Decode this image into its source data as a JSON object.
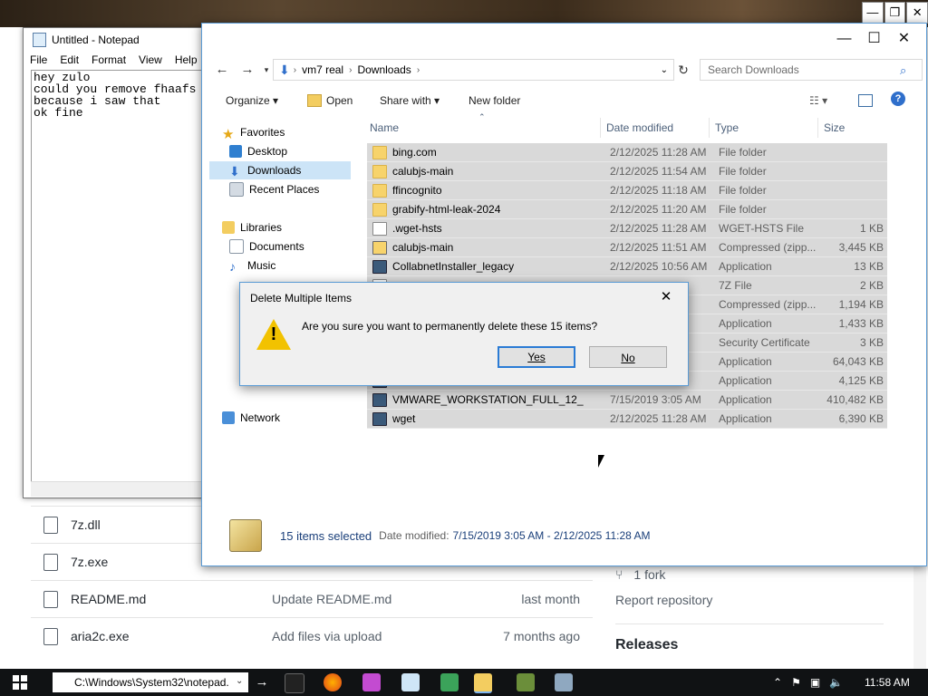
{
  "background": {
    "window_buttons": [
      "—",
      "❐",
      "✕"
    ],
    "files": [
      {
        "name": "7z.dll",
        "message": "",
        "date": ""
      },
      {
        "name": "7z.exe",
        "message": "",
        "date": ""
      },
      {
        "name": "README.md",
        "message": "Update README.md",
        "date": "last month"
      },
      {
        "name": "aria2c.exe",
        "message": "Add files via upload",
        "date": "7 months ago"
      }
    ],
    "sidebar": {
      "forks": "1 fork",
      "report": "Report repository",
      "releases": "Releases"
    }
  },
  "notepad": {
    "title": "Untitled - Notepad",
    "menu": [
      "File",
      "Edit",
      "Format",
      "View",
      "Help"
    ],
    "text": "hey zulo\ncould you remove fhaafs\nbecause i saw that\nok fine"
  },
  "explorer": {
    "caption_buttons": [
      "—",
      "☐",
      "✕"
    ],
    "breadcrumb": [
      "vm7 real",
      "Downloads"
    ],
    "search_placeholder": "Search Downloads",
    "commands": {
      "organize": "Organize",
      "open": "Open",
      "share_with": "Share with",
      "new_folder": "New folder"
    },
    "nav": {
      "favorites": "Favorites",
      "desktop": "Desktop",
      "downloads": "Downloads",
      "recent_places": "Recent Places",
      "libraries": "Libraries",
      "documents": "Documents",
      "music": "Music",
      "network": "Network"
    },
    "columns": {
      "name": "Name",
      "date": "Date modified",
      "type": "Type",
      "size": "Size"
    },
    "files": [
      {
        "name": "bing.com",
        "date": "2/12/2025 11:28 AM",
        "type": "File folder",
        "size": "",
        "icon": "folder"
      },
      {
        "name": "calubjs-main",
        "date": "2/12/2025 11:54 AM",
        "type": "File folder",
        "size": "",
        "icon": "folder"
      },
      {
        "name": "ffincognito",
        "date": "2/12/2025 11:18 AM",
        "type": "File folder",
        "size": "",
        "icon": "folder"
      },
      {
        "name": "grabify-html-leak-2024",
        "date": "2/12/2025 11:20 AM",
        "type": "File folder",
        "size": "",
        "icon": "folder"
      },
      {
        "name": ".wget-hsts",
        "date": "2/12/2025 11:28 AM",
        "type": "WGET-HSTS File",
        "size": "1 KB",
        "icon": "file"
      },
      {
        "name": "calubjs-main",
        "date": "2/12/2025 11:51 AM",
        "type": "Compressed (zipp...",
        "size": "3,445 KB",
        "icon": "zip"
      },
      {
        "name": "CollabnetInstaller_legacy",
        "date": "2/12/2025 10:56 AM",
        "type": "Application",
        "size": "13 KB",
        "icon": "app"
      },
      {
        "name": "",
        "date": "",
        "type": "7Z File",
        "size": "2 KB",
        "icon": "file"
      },
      {
        "name": "",
        "date": "",
        "type": "Compressed (zipp...",
        "size": "1,194 KB",
        "icon": "zip"
      },
      {
        "name": "",
        "date": "",
        "type": "Application",
        "size": "1,433 KB",
        "icon": "app"
      },
      {
        "name": "",
        "date": "",
        "type": "Security Certificate",
        "size": "3 KB",
        "icon": "file"
      },
      {
        "name": "",
        "date": "",
        "type": "Application",
        "size": "64,043 KB",
        "icon": "app"
      },
      {
        "name": "",
        "date": "",
        "type": "Application",
        "size": "4,125 KB",
        "icon": "app"
      },
      {
        "name": "VMWARE_WORKSTATION_FULL_12_",
        "date": "7/15/2019 3:05 AM",
        "type": "Application",
        "size": "410,482 KB",
        "icon": "app"
      },
      {
        "name": "wget",
        "date": "2/12/2025 11:28 AM",
        "type": "Application",
        "size": "6,390 KB",
        "icon": "app"
      }
    ],
    "status": {
      "count": "15 items selected",
      "date_label": "Date modified:",
      "date_range": "7/15/2019 3:05 AM - 2/12/2025 11:28 AM"
    }
  },
  "dialog": {
    "title": "Delete Multiple Items",
    "message": "Are you sure you want to permanently delete these 15 items?",
    "yes": "Yes",
    "no": "No",
    "close": "✕"
  },
  "taskbar": {
    "run_command": "C:\\Windows\\System32\\notepad.",
    "clock": "11:58 AM",
    "colors": {
      "accent": "#2a7bd5",
      "taskbar": "#101214",
      "selection": "#d9d9d9"
    }
  }
}
